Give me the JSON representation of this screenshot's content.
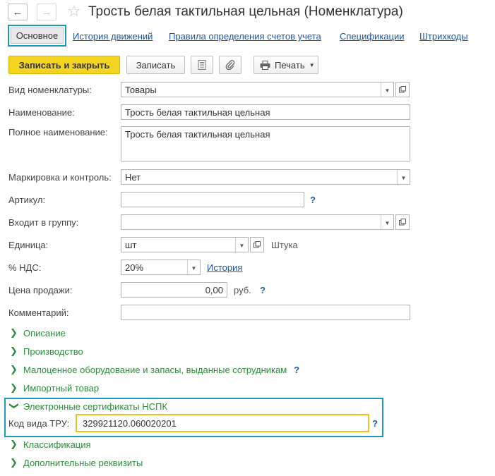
{
  "header": {
    "back_icon": "arrow-left-icon",
    "forward_icon": "arrow-right-icon",
    "favorite_icon": "star-icon",
    "title": "Трость белая тактильная цельная (Номенклатура)"
  },
  "tabs": [
    {
      "label": "Основное",
      "active": true
    },
    {
      "label": "История движений"
    },
    {
      "label": "Правила определения счетов учета"
    },
    {
      "label": "Спецификации"
    },
    {
      "label": "Штрихкоды"
    }
  ],
  "toolbar": {
    "save_close": "Записать и закрыть",
    "save": "Записать",
    "doc_icon": "document-list-icon",
    "attach_icon": "paperclip-icon",
    "print_icon": "printer-icon",
    "print": "Печать"
  },
  "form": {
    "kind_label": "Вид номенклатуры:",
    "kind_value": "Товары",
    "name_label": "Наименование:",
    "name_value": "Трость белая тактильная цельная",
    "fullname_label": "Полное наименование:",
    "fullname_value": "Трость белая тактильная цельная",
    "marking_label": "Маркировка и контроль:",
    "marking_value": "Нет",
    "article_label": "Артикул:",
    "article_value": "",
    "group_label": "Входит в группу:",
    "group_value": "",
    "unit_label": "Единица:",
    "unit_value": "шт",
    "unit_name": "Штука",
    "vat_label": "% НДС:",
    "vat_value": "20%",
    "vat_history": "История",
    "price_label": "Цена продажи:",
    "price_value": "0,00",
    "price_currency": "руб.",
    "comment_label": "Комментарий:",
    "comment_value": "",
    "help": "?"
  },
  "groups": {
    "description": "Описание",
    "production": "Производство",
    "low_value": "Малоценное оборудование и запасы, выданные сотрудникам",
    "imported": "Импортный товар",
    "certificates": "Электронные сертификаты НСПК",
    "tru_label": "Код вида ТРУ:",
    "tru_value": "329921120.060020201",
    "classification": "Классификация",
    "additional": "Дополнительные реквизиты"
  },
  "colors": {
    "accent_frame": "#1a9ac0",
    "primary_button": "#f3d51f",
    "highlight_field": "#f0c419",
    "group_text": "#2e8b3e",
    "link": "#1d55a5"
  }
}
